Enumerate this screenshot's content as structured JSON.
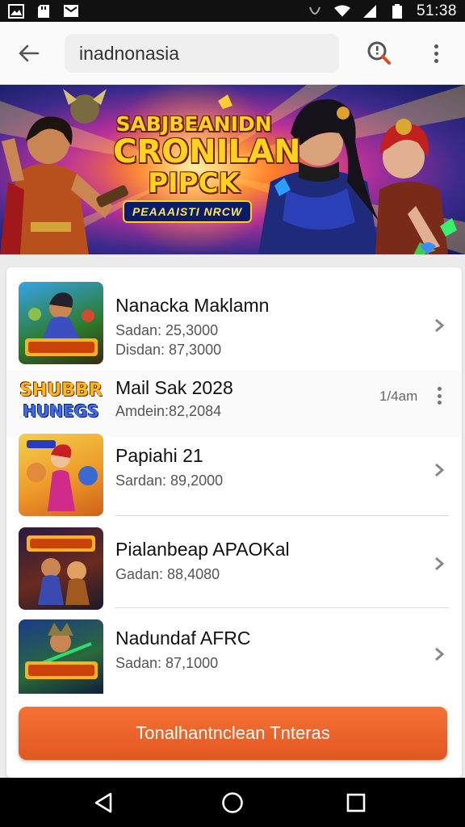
{
  "status_bar": {
    "time": "51:38",
    "left_icons": [
      "gallery-icon",
      "sd-card-icon",
      "message-icon"
    ],
    "right_icons": [
      "vibrate-icon",
      "wifi-icon",
      "signal-icon",
      "battery-icon"
    ]
  },
  "app_bar": {
    "search_value": "inadnonasia",
    "back_icon": "arrow-left-icon",
    "search_icon": "search-icon",
    "more_icon": "more-vertical-icon"
  },
  "banner": {
    "title_line1": "SABJBEANIDN",
    "title_line2": "CRONILAN",
    "title_line3": "PIPCK",
    "tag": "PEAAAISTI NRCW"
  },
  "list": {
    "items": [
      {
        "title": "Nanacka Maklamn",
        "line1": "Sadan: 25,3000",
        "line2": "Disdan: 87,3000",
        "thumb": "game-art-1"
      },
      {
        "title": "Mail Sak 2028",
        "line1": "Amdein:82,2084",
        "time": "1/4am",
        "logo_line1": "SHUBBR",
        "logo_line2": "HUNEGS",
        "thumb": "game-logo-2"
      },
      {
        "title": "Papiahi 21",
        "line1": "Sardan: 89,2000",
        "thumb": "game-art-3"
      },
      {
        "title": "Pialanbeap APAOKal",
        "line1": "Gadan: 88,4080",
        "thumb": "game-art-4"
      },
      {
        "title": "Nadundaf AFRC",
        "line1": "Sadan: 87,1000",
        "thumb": "game-art-5"
      }
    ]
  },
  "cta": {
    "label": "Tonalhantnclean Tnteras"
  },
  "nav": {
    "back_icon": "triangle-back-icon",
    "home_icon": "circle-home-icon",
    "recents_icon": "square-recents-icon"
  },
  "colors": {
    "accent": "#e85d26",
    "text": "#111111",
    "subtext": "#555555"
  }
}
